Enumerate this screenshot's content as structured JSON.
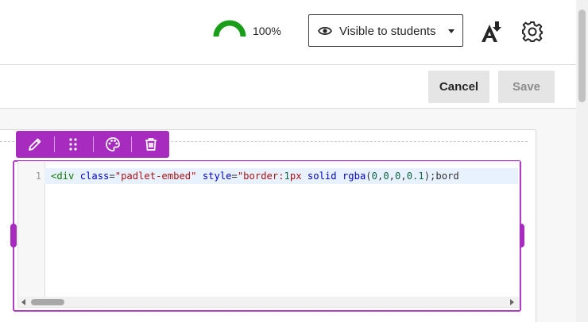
{
  "header": {
    "score_label": "100%",
    "visibility_label": "Visible to students",
    "colors": {
      "gauge": "#1a9e1a",
      "accent": "#a72bbf"
    },
    "icons": [
      "eye-icon",
      "caret-down-icon",
      "ally-download-icon",
      "gear-icon"
    ]
  },
  "actions": {
    "cancel_label": "Cancel",
    "save_label": "Save"
  },
  "toolbar": {
    "icons": [
      "pencil-icon",
      "drag-handle-icon",
      "palette-icon",
      "trash-icon"
    ]
  },
  "editor": {
    "line_number": "1",
    "code_tokens": [
      {
        "type": "tag",
        "text": "<div"
      },
      {
        "type": "plain",
        "text": " "
      },
      {
        "type": "attr",
        "text": "class"
      },
      {
        "type": "plain",
        "text": "="
      },
      {
        "type": "str",
        "text": "\"padlet-embed\""
      },
      {
        "type": "plain",
        "text": " "
      },
      {
        "type": "attr",
        "text": "style"
      },
      {
        "type": "plain",
        "text": "="
      },
      {
        "type": "str",
        "text": "\"border:"
      },
      {
        "type": "num",
        "text": "1"
      },
      {
        "type": "str",
        "text": "px "
      },
      {
        "type": "attr",
        "text": "solid"
      },
      {
        "type": "plain",
        "text": " "
      },
      {
        "type": "attr",
        "text": "rgba"
      },
      {
        "type": "plain",
        "text": "("
      },
      {
        "type": "num",
        "text": "0"
      },
      {
        "type": "plain",
        "text": ","
      },
      {
        "type": "num",
        "text": "0"
      },
      {
        "type": "plain",
        "text": ","
      },
      {
        "type": "num",
        "text": "0"
      },
      {
        "type": "plain",
        "text": ","
      },
      {
        "type": "num",
        "text": "0.1"
      },
      {
        "type": "plain",
        "text": ");bord"
      }
    ]
  }
}
